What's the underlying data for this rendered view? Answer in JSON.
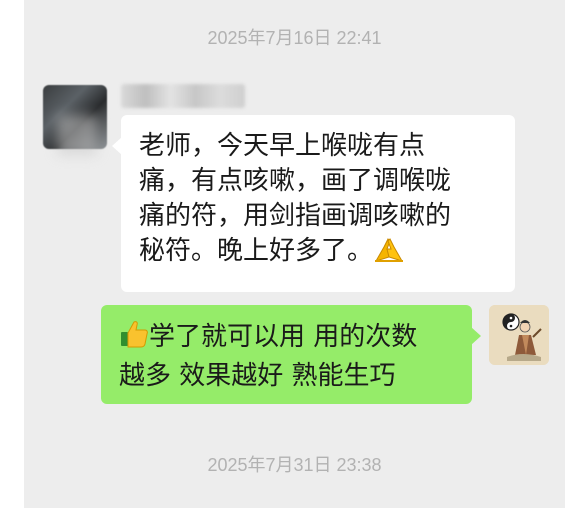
{
  "timestamps": [
    "2025年7月16日 22:41",
    "2025年7月31日 23:38"
  ],
  "left_message": {
    "sender_name": "",
    "lines": [
      "老师，今天早上喉咙有点",
      "痛，有点咳嗽，画了调喉咙",
      "痛的符，用剑指画调咳嗽的",
      "秘符。晚上好多了。"
    ],
    "trailing_emoji": "pray-hands-icon"
  },
  "right_message": {
    "leading_emoji": "thumbs-up-icon",
    "lines": [
      "学了就可以用 用的次数",
      "越多 效果越好 熟能生巧"
    ]
  },
  "colors": {
    "chat_background": "#ededed",
    "incoming_bubble": "#ffffff",
    "outgoing_bubble": "#95ec69",
    "timestamp": "#b2b2b2"
  }
}
